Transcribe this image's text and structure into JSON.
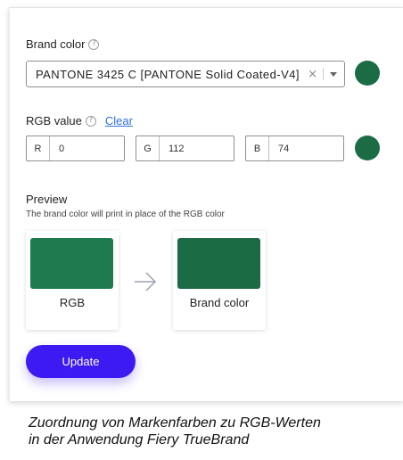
{
  "brand_color": {
    "label": "Brand color",
    "help_icon": "?",
    "select_value": "PANTONE 3425 C [PANTONE Solid Coated-V4]",
    "clear_icon": "×",
    "swatch_color": "#1b6b44"
  },
  "rgb": {
    "label": "RGB value",
    "help_icon": "?",
    "clear_label": "Clear",
    "fields": [
      {
        "letter": "R",
        "value": "0"
      },
      {
        "letter": "G",
        "value": "112"
      },
      {
        "letter": "B",
        "value": "74"
      }
    ],
    "swatch_color": "#1b6b44"
  },
  "preview": {
    "title": "Preview",
    "subtitle": "The brand color will print in place of the RGB color",
    "cards": [
      {
        "label": "RGB",
        "color": "#1e7b4f"
      },
      {
        "label": "Brand color",
        "color": "#1b6b44"
      }
    ],
    "arrow_icon": "arrow-right-icon"
  },
  "actions": {
    "update_label": "Update",
    "accent_color": "#3d19f2"
  },
  "caption": {
    "line1": "Zuordnung von Markenfarben zu RGB-Werten",
    "line2": "in der Anwendung Fiery TrueBrand"
  }
}
